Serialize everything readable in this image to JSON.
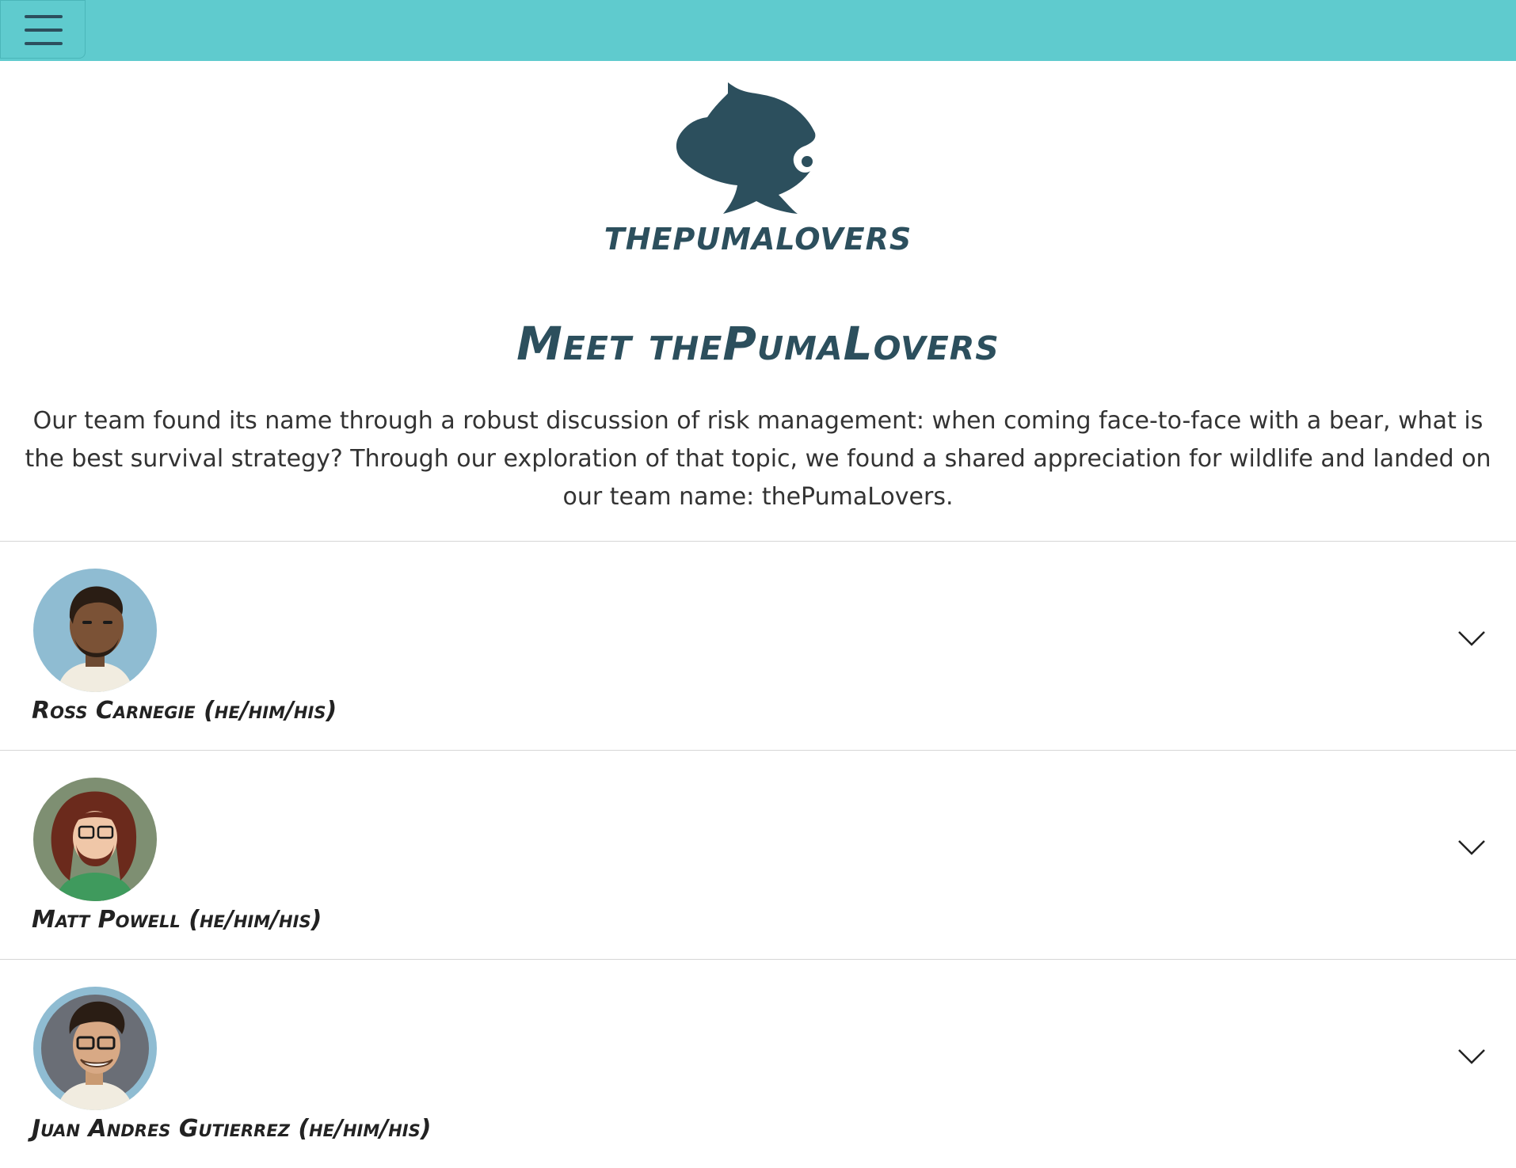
{
  "nav": {
    "menu_icon": "hamburger-menu-icon"
  },
  "logo": {
    "icon": "puma-head-logo",
    "wordmark": "thePumaLovers"
  },
  "heading": "Meet thePumaLovers",
  "intro": "Our team found its name through a robust discussion of risk management: when coming face-to-face with a bear, what is the best survival strategy? Through our exploration of that topic, we found a shared appreciation for wildlife and landed on our team name: thePumaLovers.",
  "members": [
    {
      "name": "Ross Carnegie (he/him/his)",
      "expand_icon": "chevron-down-icon"
    },
    {
      "name": "Matt Powell (he/him/his)",
      "expand_icon": "chevron-down-icon"
    },
    {
      "name": "Juan Andres Gutierrez (he/him/his)",
      "expand_icon": "chevron-down-icon"
    }
  ],
  "colors": {
    "topbar": "#5fcbce",
    "brand": "#2c4f5d"
  }
}
